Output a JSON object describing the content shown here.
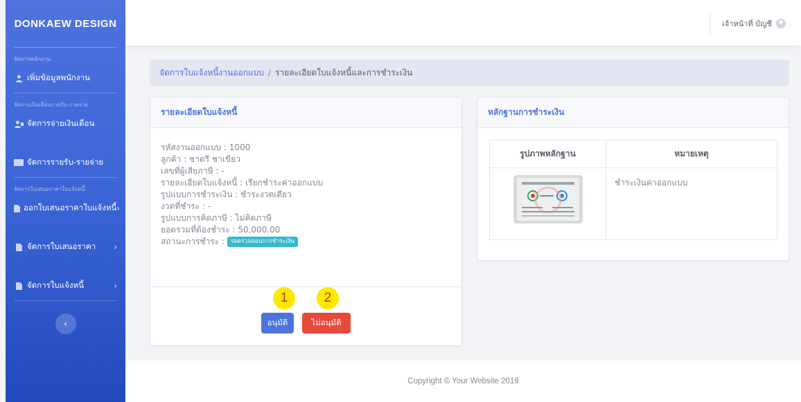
{
  "sidebar": {
    "brand": "DONKAEW DESIGN",
    "sections": [
      {
        "heading": "จัดการพนักงาน",
        "items": [
          {
            "label": "เพิ่มข้อมูลพนักงาน",
            "icon": "user-icon"
          }
        ]
      },
      {
        "heading": "จัดการเงินเดือนรายรับ-รายจ่าย",
        "items": [
          {
            "label": "จัดการจ่ายเงินเดือน",
            "icon": "user-money-icon"
          },
          {
            "label": "จัดการรายรับ-รายจ่าย",
            "icon": "wallet-icon"
          }
        ]
      },
      {
        "heading": "จัดการใบเสนอราคาใบแจ้งหนี้",
        "items": [
          {
            "label": "ออกใบเสนอราคาใบแจ้งหนี้",
            "icon": "document-icon"
          },
          {
            "label": "จัดการใบเสนอราคา",
            "icon": "document-icon"
          },
          {
            "label": "จัดการใบแจ้งหนี้",
            "icon": "document-icon"
          }
        ]
      }
    ],
    "toggle_icon": "chevron-left-icon"
  },
  "topbar": {
    "user_label": "เจ้าหน้าที่ บัญชี",
    "avatar_icon": "user-circle-icon"
  },
  "breadcrumb": {
    "link": "จัดการใบแจ้งหนี้งานออกแบบ",
    "separator": "/",
    "current": "รายละเอียดใบแจ้งหนี้และการชำระเงิน"
  },
  "invoice_card": {
    "title": "รายละเอียดใบแจ้งหนี้",
    "rows": [
      "รหัสงานออกแบบ : 1000",
      "ลูกค้า : ชาตรี ชาเขียว",
      "เลขที่ผู้เสียภาษี : -",
      "รายละเอียดใบแจ้งหนี้ : เรียกชำระค่าออกแบบ",
      "รูปแบบการชำระเงิน : ชำระงวดเดียว",
      "งวดที่ชำระ : -",
      "รูปแบบการคิดภาษี : ไม่คิดภาษี",
      "ยอดรวมที่ต้องชำระ : 50,000.00"
    ],
    "status_label": "สถานะการชำระ :",
    "status_badge": "รอตรวจสอบการชำระเงิน",
    "approve_label": "อนุมัติ",
    "reject_label": "ไม่อนุมัติ",
    "marker_1": "1",
    "marker_2": "2"
  },
  "evidence_card": {
    "title": "หลักฐานการชำระเงิน",
    "col_image": "รูปภาพหลักฐาน",
    "col_note": "หมายเหตุ",
    "note": "ชำระเงินค่าออกแบบ"
  },
  "footer": {
    "copyright": "Copyright © Your Website 2019"
  },
  "colors": {
    "primary": "#4e73df",
    "danger": "#e74a3b",
    "info": "#36b9cc"
  }
}
